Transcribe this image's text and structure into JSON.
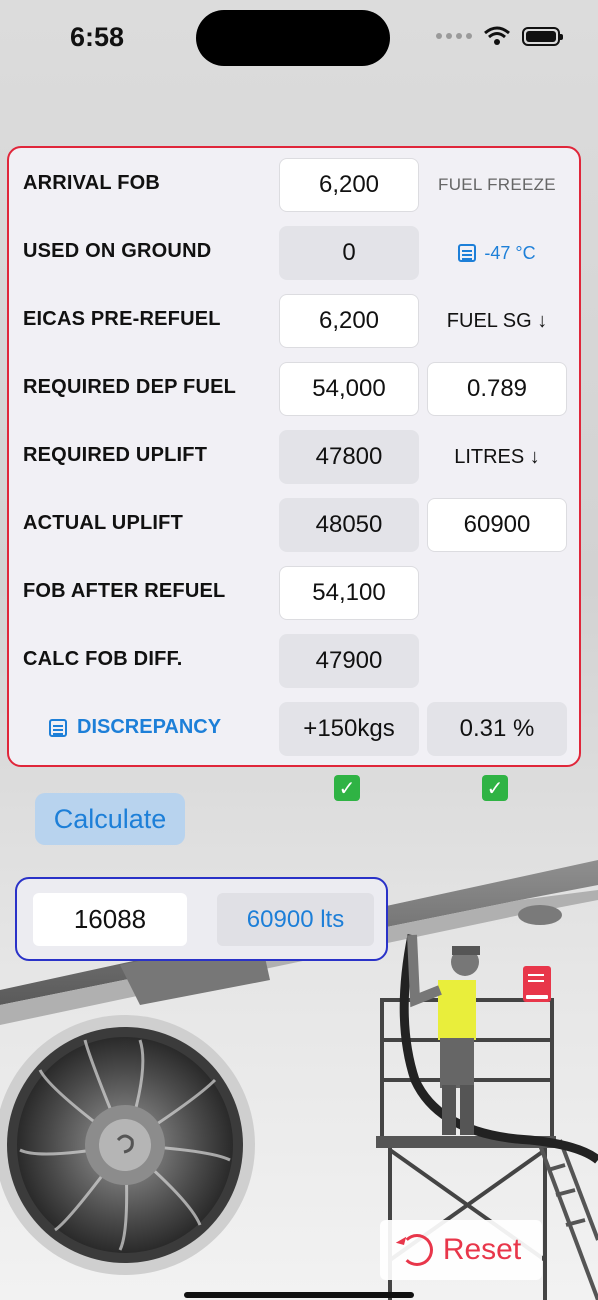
{
  "status": {
    "time": "6:58"
  },
  "rows": [
    {
      "label": "ARRIVAL FOB",
      "value": "6,200",
      "side": "FUEL FREEZE"
    },
    {
      "label": "USED ON GROUND",
      "value": "0",
      "side": "-47 °C"
    },
    {
      "label": "EICAS PRE-REFUEL",
      "value": "6,200",
      "side": "FUEL SG ↓"
    },
    {
      "label": "REQUIRED DEP FUEL",
      "value": "54,000",
      "side": "0.789"
    },
    {
      "label": "REQUIRED UPLIFT",
      "value": "47800",
      "side": "LITRES ↓"
    },
    {
      "label": "ACTUAL UPLIFT",
      "value": "48050",
      "side": "60900"
    },
    {
      "label": "FOB AFTER REFUEL",
      "value": "54,100"
    },
    {
      "label": "CALC FOB DIFF.",
      "value": "47900"
    },
    {
      "label": "DISCREPANCY",
      "value": "+150kgs",
      "side": "0.31 %"
    }
  ],
  "checks": [
    "✓",
    "✓"
  ],
  "calculate_label": "Calculate",
  "result": {
    "left": "16088",
    "right": "60900 lts"
  },
  "reset_label": "Reset",
  "icons": {
    "doc": "doc-text-icon",
    "book": "book-icon",
    "reset": "rotate-ccw-icon",
    "wifi": "wifi-icon",
    "battery": "battery-icon",
    "check": "checkmark-icon"
  },
  "colors": {
    "accent_blue": "#1d7fd8",
    "card_border_red": "#e0263a",
    "result_border_blue": "#2a32c8",
    "check_green": "#2fb344",
    "reset_red": "#e8364a"
  }
}
